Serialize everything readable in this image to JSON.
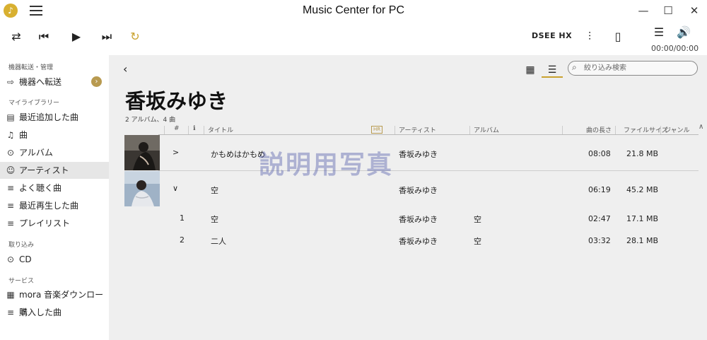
{
  "window": {
    "title": "Music Center for PC",
    "minimize": "—",
    "maximize": "☐",
    "close": "✕"
  },
  "transport": {
    "shuffle_icon": "⇄",
    "prev_icon": "⏮",
    "play_icon": "▶",
    "next_icon": "⏭",
    "repeat_icon": "↻",
    "dsee": "DSEE HX",
    "equalizer_icon": "⫶",
    "device_icon": "▯",
    "queue_icon": "☰",
    "volume_icon": "🔊",
    "time": "00:00/00:00",
    "accent": "#c9a22e"
  },
  "sidebar": {
    "sections": {
      "device": "機器転送・管理",
      "library": "マイライブラリー",
      "import": "取り込み",
      "service": "サービス"
    },
    "items": [
      {
        "label": "機器へ転送",
        "icon": "transfer-icon"
      },
      {
        "label": "最近追加した曲",
        "icon": "recent-added-icon"
      },
      {
        "label": "曲",
        "icon": "note-icon"
      },
      {
        "label": "アルバム",
        "icon": "album-icon"
      },
      {
        "label": "アーティスト",
        "icon": "person-icon"
      },
      {
        "label": "よく聴く曲",
        "icon": "playlist-icon"
      },
      {
        "label": "最近再生した曲",
        "icon": "playlist-icon"
      },
      {
        "label": "プレイリスト",
        "icon": "playlist-icon"
      },
      {
        "label": "CD",
        "icon": "cd-icon"
      },
      {
        "label": "mora 音楽ダウンロード",
        "icon": "mora-icon"
      },
      {
        "label": "購入した曲",
        "icon": "playlist-icon"
      }
    ],
    "transfer_arrow": "›"
  },
  "main": {
    "back": "‹",
    "search_placeholder": "絞り込み検索",
    "artist": "香坂みゆき",
    "meta": "2 アルバム、4 曲",
    "columns": {
      "num": "#",
      "info": "ℹ",
      "title": "タイトル",
      "hr": "HR",
      "artist": "アーティスト",
      "album": "アルバム",
      "length": "曲の長さ",
      "size": "ファイルサイズ",
      "genre": "ジャンル"
    },
    "albums": [
      {
        "toggle": ">",
        "title": "かもめはかもめ",
        "artist": "香坂みゆき",
        "length": "08:08",
        "size": "21.8 MB"
      },
      {
        "toggle": "∨",
        "title": "空",
        "artist": "香坂みゆき",
        "length": "06:19",
        "size": "45.2 MB"
      }
    ],
    "tracks": [
      {
        "num": "1",
        "title": "空",
        "artist": "香坂みゆき",
        "album": "空",
        "length": "02:47",
        "size": "17.1 MB"
      },
      {
        "num": "2",
        "title": "二人",
        "artist": "香坂みゆき",
        "album": "空",
        "length": "03:32",
        "size": "28.1 MB"
      }
    ],
    "watermark": "説明用写真"
  }
}
